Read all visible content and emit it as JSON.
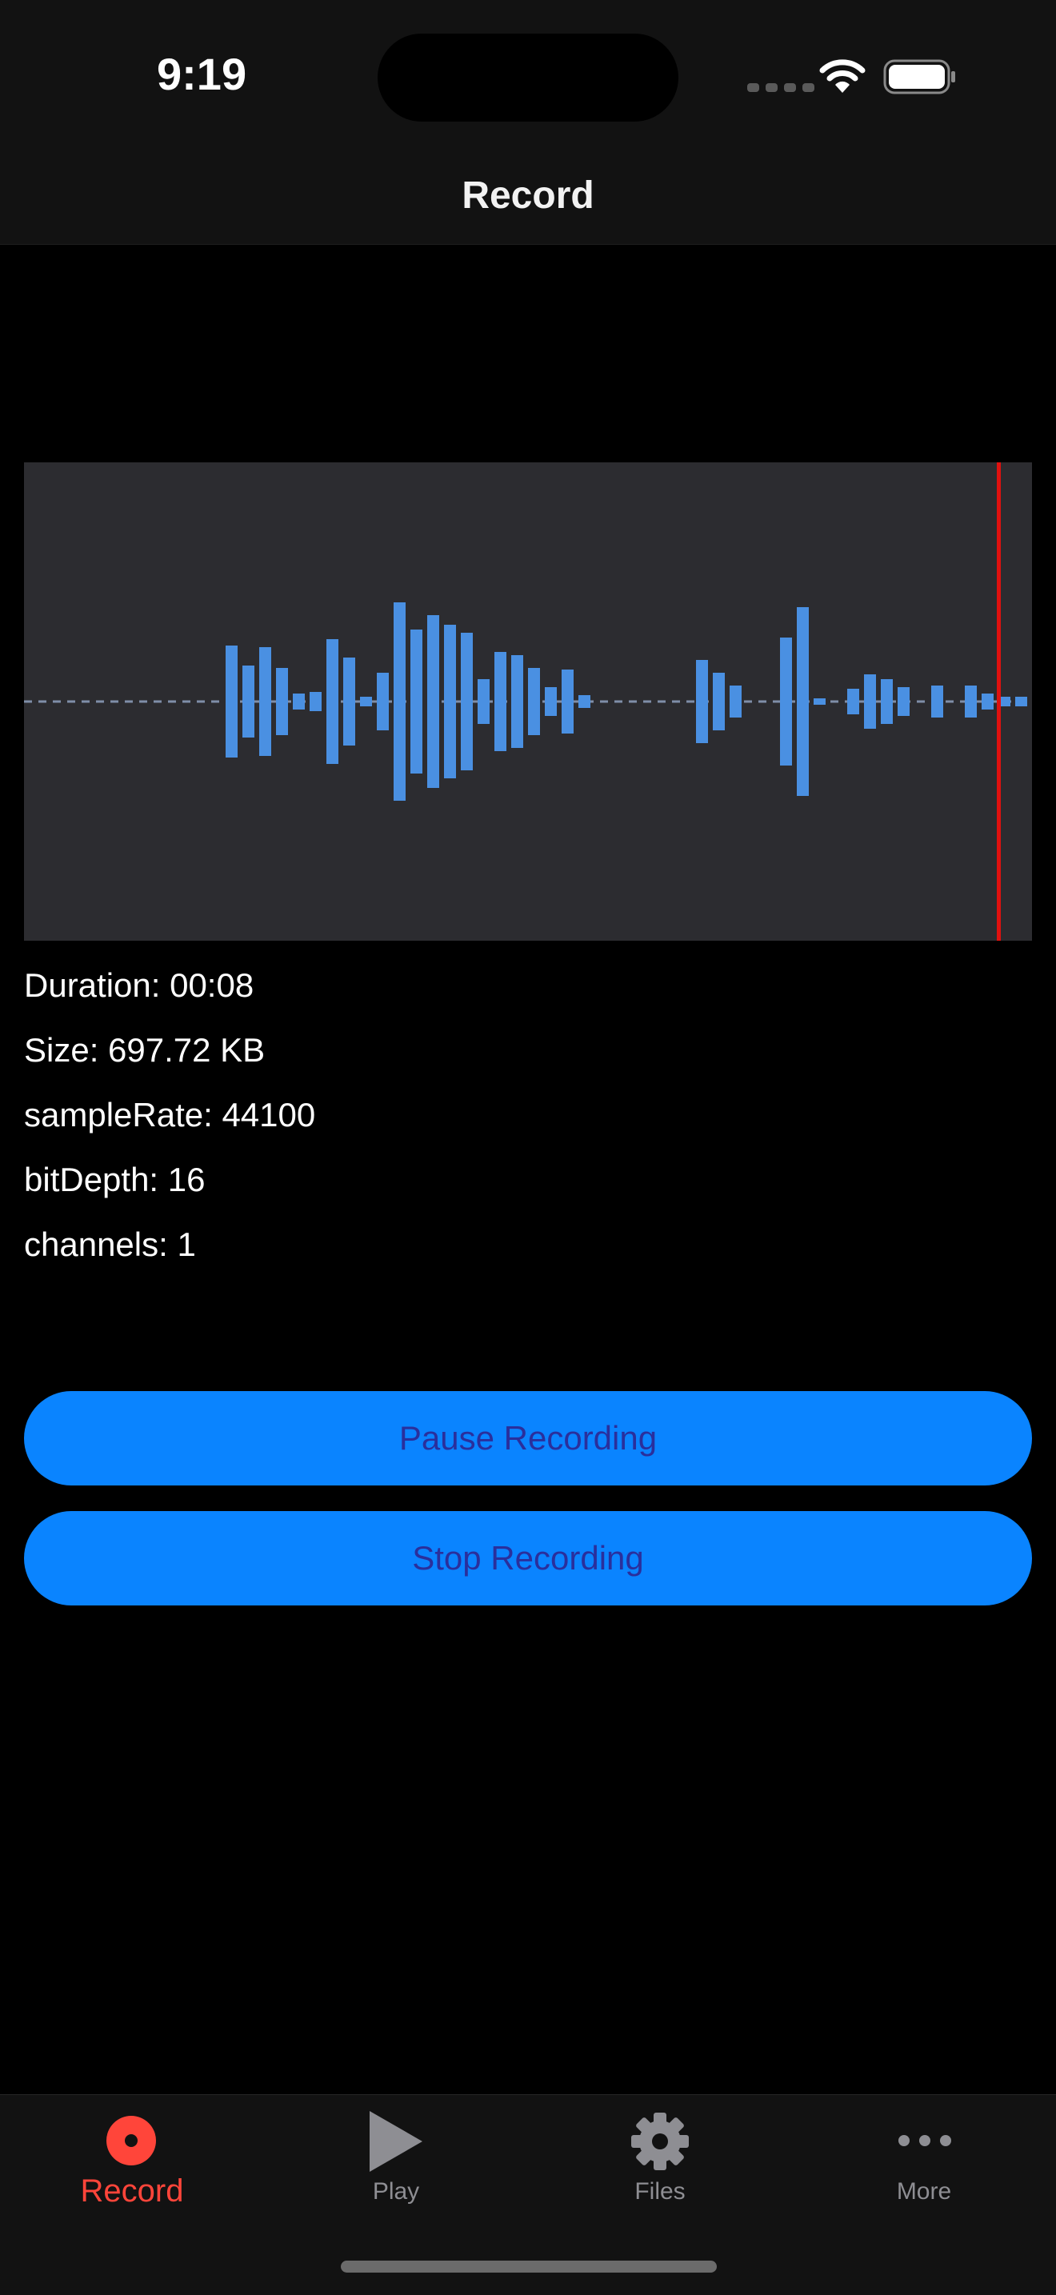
{
  "status_bar": {
    "time": "9:19"
  },
  "nav": {
    "title": "Record"
  },
  "waveform": {
    "bar_color": "#4a90e2",
    "playhead_color": "#e0110f",
    "background": "#2c2c30",
    "playhead_position": 0.967
  },
  "info": {
    "duration": "Duration: 00:08",
    "size": "Size: 697.72 KB",
    "sample_rate": "sampleRate: 44100",
    "bit_depth": "bitDepth: 16",
    "channels": "channels: 1"
  },
  "buttons": {
    "pause_label": "Pause Recording",
    "stop_label": "Stop Recording",
    "color": "#0a84ff"
  },
  "tabs": [
    {
      "label": "Record",
      "icon": "record-icon",
      "active": true
    },
    {
      "label": "Play",
      "icon": "play-icon",
      "active": false
    },
    {
      "label": "Files",
      "icon": "gear-icon",
      "active": false
    },
    {
      "label": "More",
      "icon": "ellipsis-icon",
      "active": false
    }
  ],
  "colors": {
    "accent": "#ff453a",
    "inactive": "#8e8e93"
  }
}
